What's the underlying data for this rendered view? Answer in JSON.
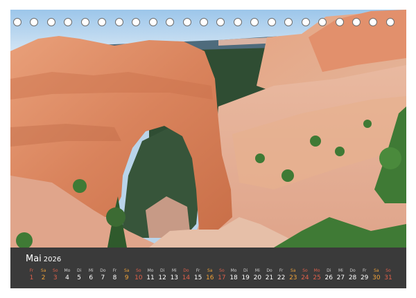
{
  "calendar": {
    "month": "Mai",
    "year": "2026",
    "accent_colors": {
      "sunday": "#e0604a",
      "saturday": "#f0a238",
      "weekday": "#ffffff",
      "strip_bg": "#3a3a3a"
    },
    "days": [
      {
        "wd": "Fr",
        "d": "1",
        "type": "hol"
      },
      {
        "wd": "Sa",
        "d": "2",
        "type": "sat"
      },
      {
        "wd": "So",
        "d": "3",
        "type": "sun"
      },
      {
        "wd": "Mo",
        "d": "4",
        "type": "wk"
      },
      {
        "wd": "Di",
        "d": "5",
        "type": "wk"
      },
      {
        "wd": "Mi",
        "d": "6",
        "type": "wk"
      },
      {
        "wd": "Do",
        "d": "7",
        "type": "wk"
      },
      {
        "wd": "Fr",
        "d": "8",
        "type": "wk"
      },
      {
        "wd": "Sa",
        "d": "9",
        "type": "sat"
      },
      {
        "wd": "So",
        "d": "10",
        "type": "sun"
      },
      {
        "wd": "Mo",
        "d": "11",
        "type": "wk"
      },
      {
        "wd": "Di",
        "d": "12",
        "type": "wk"
      },
      {
        "wd": "Mi",
        "d": "13",
        "type": "wk"
      },
      {
        "wd": "Do",
        "d": "14",
        "type": "hol"
      },
      {
        "wd": "Fr",
        "d": "15",
        "type": "wk"
      },
      {
        "wd": "Sa",
        "d": "16",
        "type": "sat"
      },
      {
        "wd": "So",
        "d": "17",
        "type": "sun"
      },
      {
        "wd": "Mo",
        "d": "18",
        "type": "wk"
      },
      {
        "wd": "Di",
        "d": "19",
        "type": "wk"
      },
      {
        "wd": "Mi",
        "d": "20",
        "type": "wk"
      },
      {
        "wd": "Do",
        "d": "21",
        "type": "wk"
      },
      {
        "wd": "Fr",
        "d": "22",
        "type": "wk"
      },
      {
        "wd": "Sa",
        "d": "23",
        "type": "sat"
      },
      {
        "wd": "So",
        "d": "24",
        "type": "sun"
      },
      {
        "wd": "Mo",
        "d": "25",
        "type": "hol"
      },
      {
        "wd": "Di",
        "d": "26",
        "type": "wk"
      },
      {
        "wd": "Mi",
        "d": "27",
        "type": "wk"
      },
      {
        "wd": "Do",
        "d": "28",
        "type": "wk"
      },
      {
        "wd": "Fr",
        "d": "29",
        "type": "wk"
      },
      {
        "wd": "Sa",
        "d": "30",
        "type": "sat"
      },
      {
        "wd": "So",
        "d": "31",
        "type": "sun"
      }
    ]
  },
  "binding": {
    "ring_count": 23
  }
}
